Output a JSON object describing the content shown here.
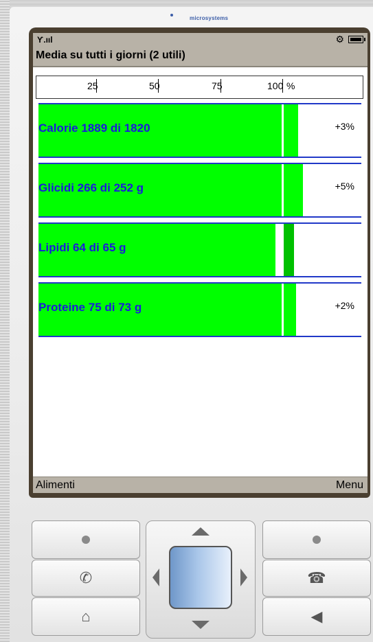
{
  "brand": {
    "name": "microsystems"
  },
  "status": {
    "signal": "Ƴ.ııl"
  },
  "screen": {
    "title": "Media su tutti i giorni  (2 utili)"
  },
  "scale": {
    "ticks": [
      "25",
      "50",
      "75",
      "100",
      "%"
    ]
  },
  "nutrients": [
    {
      "label": "Calorie 1889 di 1820",
      "value": 1889,
      "target": 1820,
      "delta": "+3%"
    },
    {
      "label": "Glicidi 266 di 252 g",
      "value": 266,
      "target": 252,
      "delta": "+5%"
    },
    {
      "label": "Lipidi 64 di 65 g",
      "value": 64,
      "target": 65,
      "delta": ""
    },
    {
      "label": "Proteine 75 di 73 g",
      "value": 75,
      "target": 73,
      "delta": "+2%"
    }
  ],
  "softkeys": {
    "left": "Alimenti",
    "right": "Menu"
  },
  "colors": {
    "bar": "#00ff00",
    "under": "#00c000",
    "line": "#2038c8",
    "label": "#1a1adc",
    "bars_bg": "#b8b2a7"
  },
  "keys": {
    "left_top": "dot-icon",
    "left_mid": "phone-call-icon",
    "left_bottom": "home-icon",
    "right_top": "dot-icon",
    "right_mid": "phone-hangup-icon",
    "right_bottom": "back-icon"
  }
}
